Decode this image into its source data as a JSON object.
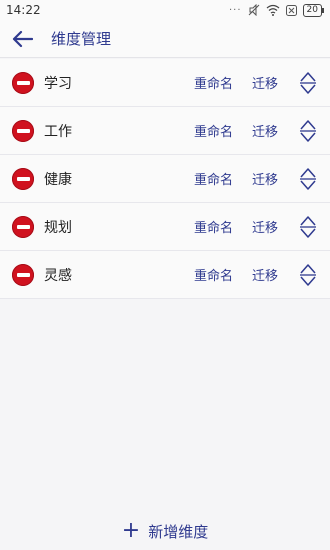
{
  "status": {
    "time": "14:22",
    "battery": "20"
  },
  "header": {
    "title": "维度管理"
  },
  "items": [
    {
      "label": "学习",
      "rename": "重命名",
      "migrate": "迁移"
    },
    {
      "label": "工作",
      "rename": "重命名",
      "migrate": "迁移"
    },
    {
      "label": "健康",
      "rename": "重命名",
      "migrate": "迁移"
    },
    {
      "label": "规划",
      "rename": "重命名",
      "migrate": "迁移"
    },
    {
      "label": "灵感",
      "rename": "重命名",
      "migrate": "迁移"
    }
  ],
  "footer": {
    "add_label": "新增维度"
  },
  "colors": {
    "accent": "#2f3a8f",
    "delete": "#d0121f"
  },
  "icons": {
    "back": "arrow-left-icon",
    "remove": "minus-circle-icon",
    "drag": "up-down-arrows-icon",
    "add": "plus-icon"
  }
}
